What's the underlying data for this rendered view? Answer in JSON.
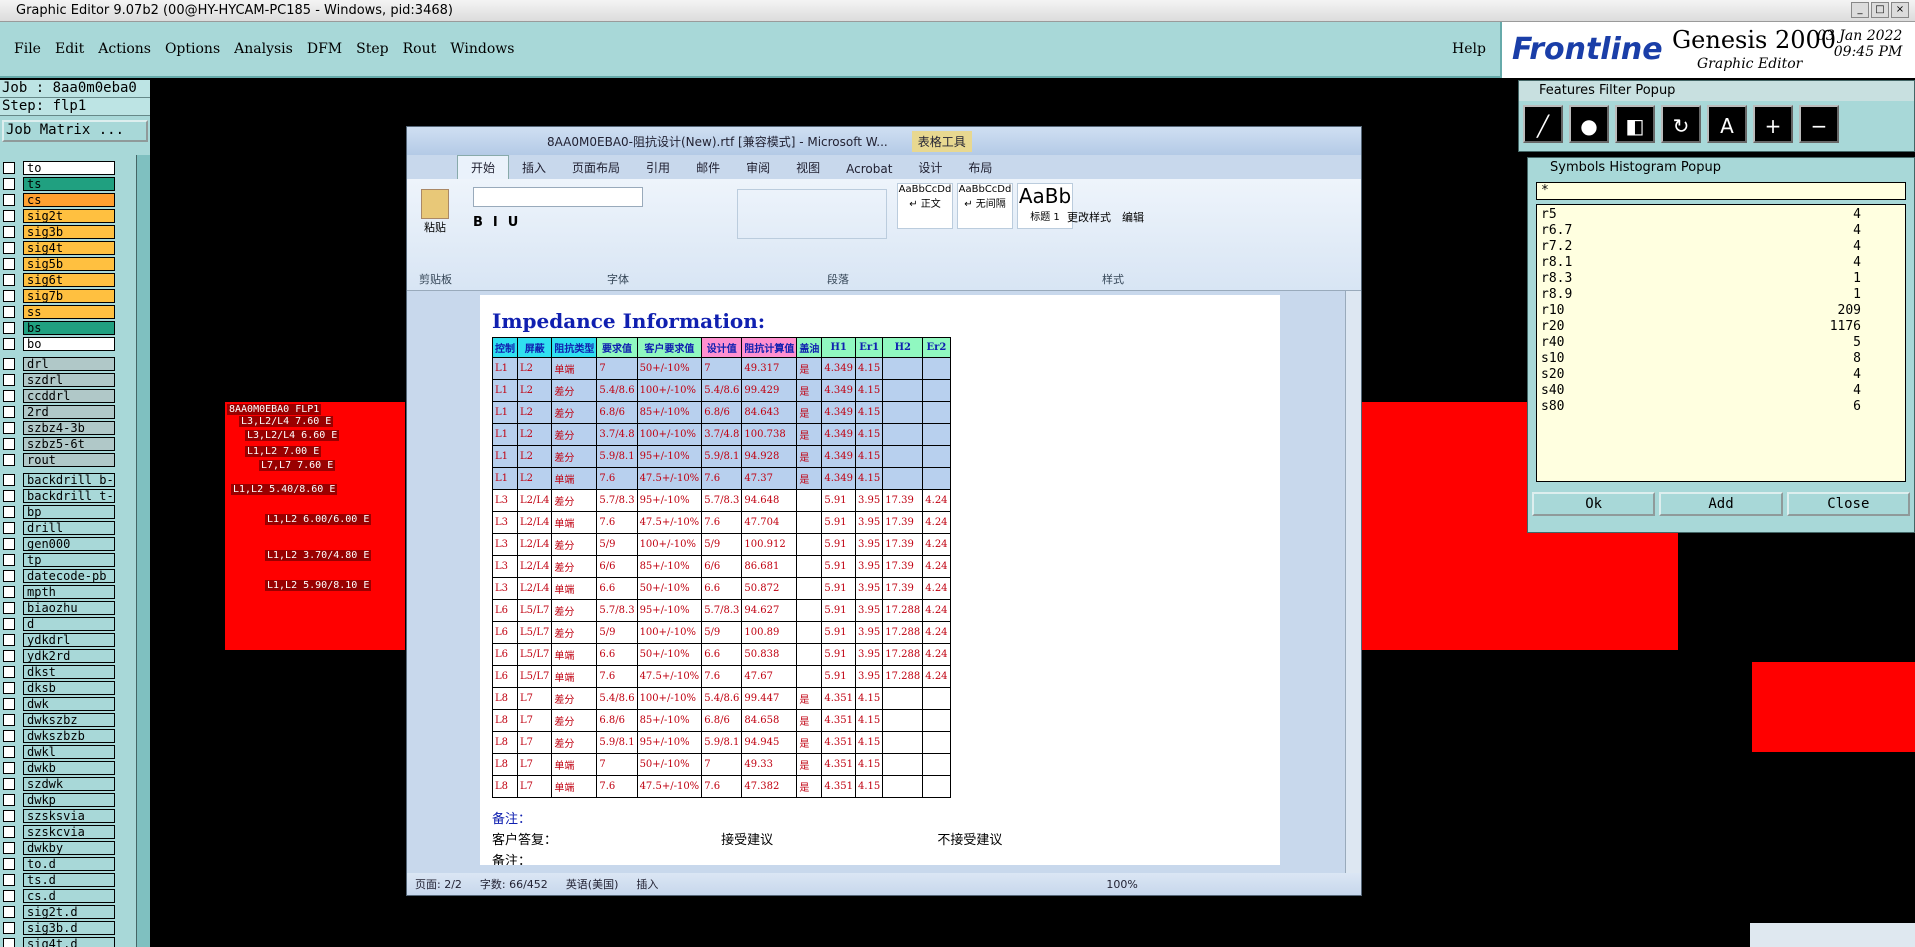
{
  "window_title": "Graphic Editor 9.07b2 (00@HY-HYCAM-PC185 - Windows, pid:3468)",
  "menu": [
    "File",
    "Edit",
    "Actions",
    "Options",
    "Analysis",
    "DFM",
    "Step",
    "Rout",
    "Windows"
  ],
  "help": "Help",
  "brand": {
    "frontline": "Frontline",
    "genesis": "Genesis 2000",
    "subtitle": "Graphic Editor",
    "date": "03 Jan 2022",
    "time": "09:45 PM"
  },
  "job": "Job : 8aa0m0eba0",
  "step": "Step: flp1",
  "job_matrix": "Job Matrix ...",
  "layers_a": [
    {
      "name": "to",
      "color": "#ffffff"
    },
    {
      "name": "ts",
      "color": "#20a080"
    },
    {
      "name": "cs",
      "color": "#ffa030"
    },
    {
      "name": "sig2t",
      "color": "#ffc040"
    },
    {
      "name": "sig3b",
      "color": "#ffc040"
    },
    {
      "name": "sig4t",
      "color": "#ffc040"
    },
    {
      "name": "sig5b",
      "color": "#ffc040"
    },
    {
      "name": "sig6t",
      "color": "#ffc040"
    },
    {
      "name": "sig7b",
      "color": "#ffc040"
    },
    {
      "name": "ss",
      "color": "#ffc040"
    },
    {
      "name": "bs",
      "color": "#20a080"
    },
    {
      "name": "bo",
      "color": "#ffffff"
    }
  ],
  "layers_b": [
    "drl",
    "szdrl",
    "ccddrl",
    "2rd",
    "szbz4-3b",
    "szbz5-6t",
    "rout"
  ],
  "layers_c": [
    "backdrill_b-",
    "backdrill_t-",
    "bp",
    "drill",
    "gen000",
    "tp",
    "datecode-pb",
    "mpth",
    "biaozhu",
    "d",
    "ydkdrl",
    "ydk2rd",
    "dkst",
    "dksb",
    "dwk",
    "dwkszbz",
    "dwkszbzb",
    "dwkl",
    "dwkb",
    "szdwk",
    "dwkp",
    "szsksvia",
    "szskcvia",
    "dwkby",
    "to.d",
    "ts.d",
    "cs.d",
    "sig2t.d",
    "sig3b.d",
    "sig4t.d"
  ],
  "pcb_labels": [
    "8AA0M0EBA0 FLP1",
    "L3,L2/L4 7.60 E",
    "L3,L2/L4 6.60 E",
    "L1,L2 7.00 E",
    "L7,L7 7.60 E",
    "L1,L2 5.40/8.60 E",
    "L1,L2 6.00/6.00 E",
    "L1,L2 3.70/4.80 E",
    "L1,L2 5.90/8.10 E"
  ],
  "word": {
    "title": "8AA0M0EBA0-阻抗设计(New).rtf [兼容模式] - Microsoft W...",
    "context_tab": "表格工具",
    "tabs": [
      "开始",
      "插入",
      "页面布局",
      "引用",
      "邮件",
      "审阅",
      "视图",
      "Acrobat",
      "设计",
      "布局"
    ],
    "groups": [
      "剪贴板",
      "字体",
      "段落",
      "样式"
    ],
    "styles": [
      "AaBbCcDd",
      "AaBbCcDd",
      "AaBb"
    ],
    "style_names": [
      "↵ 正文",
      "↵ 无间隔",
      "标题 1"
    ],
    "change_styles": "更改样式",
    "edit": "编辑",
    "paste": "粘贴",
    "status": {
      "page": "页面: 2/2",
      "words": "字数: 66/452",
      "lang": "英语(美国)",
      "mode": "插入",
      "zoom": "100%"
    }
  },
  "doc": {
    "heading": "Impedance Information:",
    "headers": [
      "控制",
      "屏蔽",
      "阻抗类型",
      "要求值",
      "客户要求值",
      "设计值",
      "阻抗计算值",
      "盖油",
      "H1",
      "Er1",
      "H2",
      "Er2"
    ],
    "rows": [
      [
        "L1",
        "L2",
        "单端",
        "7",
        "50+/-10%",
        "7",
        "49.317",
        "是",
        "4.349",
        "4.15",
        "",
        ""
      ],
      [
        "L1",
        "L2",
        "差分",
        "5.4/8.6",
        "100+/-10%",
        "5.4/8.6",
        "99.429",
        "是",
        "4.349",
        "4.15",
        "",
        ""
      ],
      [
        "L1",
        "L2",
        "差分",
        "6.8/6",
        "85+/-10%",
        "6.8/6",
        "84.643",
        "是",
        "4.349",
        "4.15",
        "",
        ""
      ],
      [
        "L1",
        "L2",
        "差分",
        "3.7/4.8",
        "100+/-10%",
        "3.7/4.8",
        "100.738",
        "是",
        "4.349",
        "4.15",
        "",
        ""
      ],
      [
        "L1",
        "L2",
        "差分",
        "5.9/8.1",
        "95+/-10%",
        "5.9/8.1",
        "94.928",
        "是",
        "4.349",
        "4.15",
        "",
        ""
      ],
      [
        "L1",
        "L2",
        "单端",
        "7.6",
        "47.5+/-10%",
        "7.6",
        "47.37",
        "是",
        "4.349",
        "4.15",
        "",
        ""
      ],
      [
        "L3",
        "L2/L4",
        "差分",
        "5.7/8.3",
        "95+/-10%",
        "5.7/8.3",
        "94.648",
        "",
        "5.91",
        "3.95",
        "17.39",
        "4.24"
      ],
      [
        "L3",
        "L2/L4",
        "单端",
        "7.6",
        "47.5+/-10%",
        "7.6",
        "47.704",
        "",
        "5.91",
        "3.95",
        "17.39",
        "4.24"
      ],
      [
        "L3",
        "L2/L4",
        "差分",
        "5/9",
        "100+/-10%",
        "5/9",
        "100.912",
        "",
        "5.91",
        "3.95",
        "17.39",
        "4.24"
      ],
      [
        "L3",
        "L2/L4",
        "差分",
        "6/6",
        "85+/-10%",
        "6/6",
        "86.681",
        "",
        "5.91",
        "3.95",
        "17.39",
        "4.24"
      ],
      [
        "L3",
        "L2/L4",
        "单端",
        "6.6",
        "50+/-10%",
        "6.6",
        "50.872",
        "",
        "5.91",
        "3.95",
        "17.39",
        "4.24"
      ],
      [
        "L6",
        "L5/L7",
        "差分",
        "5.7/8.3",
        "95+/-10%",
        "5.7/8.3",
        "94.627",
        "",
        "5.91",
        "3.95",
        "17.288",
        "4.24"
      ],
      [
        "L6",
        "L5/L7",
        "差分",
        "5/9",
        "100+/-10%",
        "5/9",
        "100.89",
        "",
        "5.91",
        "3.95",
        "17.288",
        "4.24"
      ],
      [
        "L6",
        "L5/L7",
        "单端",
        "6.6",
        "50+/-10%",
        "6.6",
        "50.838",
        "",
        "5.91",
        "3.95",
        "17.288",
        "4.24"
      ],
      [
        "L6",
        "L5/L7",
        "单端",
        "7.6",
        "47.5+/-10%",
        "7.6",
        "47.67",
        "",
        "5.91",
        "3.95",
        "17.288",
        "4.24"
      ],
      [
        "L8",
        "L7",
        "差分",
        "5.4/8.6",
        "100+/-10%",
        "5.4/8.6",
        "99.447",
        "是",
        "4.351",
        "4.15",
        "",
        ""
      ],
      [
        "L8",
        "L7",
        "差分",
        "6.8/6",
        "85+/-10%",
        "6.8/6",
        "84.658",
        "是",
        "4.351",
        "4.15",
        "",
        ""
      ],
      [
        "L8",
        "L7",
        "差分",
        "5.9/8.1",
        "95+/-10%",
        "5.9/8.1",
        "94.945",
        "是",
        "4.351",
        "4.15",
        "",
        ""
      ],
      [
        "L8",
        "L7",
        "单端",
        "7",
        "50+/-10%",
        "7",
        "49.33",
        "是",
        "4.351",
        "4.15",
        "",
        ""
      ],
      [
        "L8",
        "L7",
        "单端",
        "7.6",
        "47.5+/-10%",
        "7.6",
        "47.382",
        "是",
        "4.351",
        "4.15",
        "",
        ""
      ]
    ],
    "note1": "备注：",
    "reply": "客户答复：",
    "accept": "接受建议",
    "reject": "不接受建议",
    "note2": "备注："
  },
  "features_filter": {
    "title": "Features Filter Popup"
  },
  "symbols_histogram": {
    "title": "Symbols Histogram Popup",
    "filter": "*",
    "items": [
      [
        "r5",
        "4"
      ],
      [
        "r6.7",
        "4"
      ],
      [
        "r7.2",
        "4"
      ],
      [
        "r8.1",
        "4"
      ],
      [
        "r8.3",
        "1"
      ],
      [
        "r8.9",
        "1"
      ],
      [
        "r10",
        "209"
      ],
      [
        "r20",
        "1176"
      ],
      [
        "r40",
        "5"
      ],
      [
        "s10",
        "8"
      ],
      [
        "s20",
        "4"
      ],
      [
        "s40",
        "4"
      ],
      [
        "s80",
        "6"
      ]
    ],
    "buttons": [
      "Ok",
      "Add",
      "Close"
    ]
  }
}
